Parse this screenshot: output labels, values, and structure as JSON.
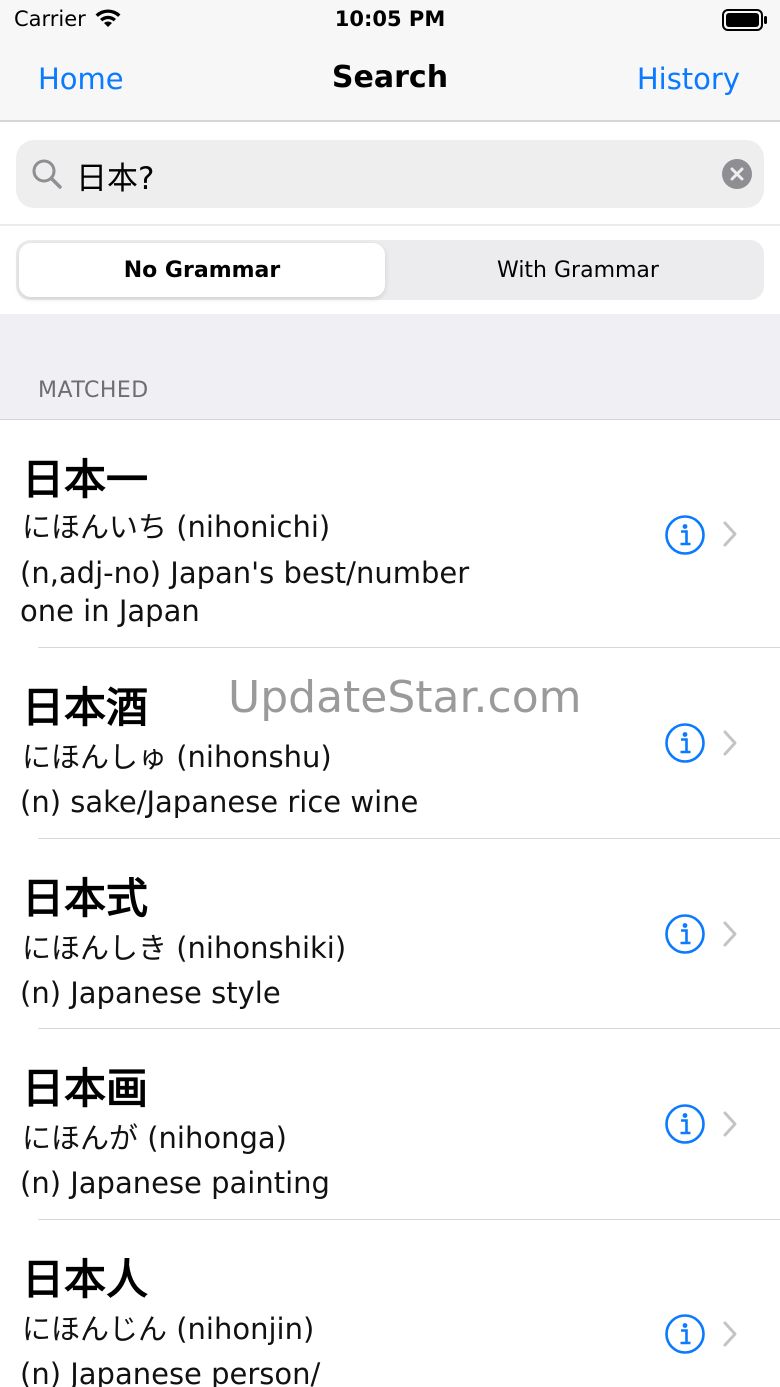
{
  "status_bar": {
    "carrier": "Carrier",
    "time": "10:05 PM"
  },
  "nav": {
    "back_label": "Home",
    "title": "Search",
    "right_label": "History"
  },
  "search": {
    "query": "日本?"
  },
  "segment": {
    "selected": "No Grammar",
    "other": "With Grammar"
  },
  "section": {
    "header": "MATCHED"
  },
  "results": [
    {
      "word": "日本一",
      "reading": "にほんいち (nihonichi)",
      "definition": "(n,adj-no) Japan's best/number one in Japan"
    },
    {
      "word": "日本酒",
      "reading": "にほんしゅ (nihonshu)",
      "definition": "(n) sake/Japanese rice wine"
    },
    {
      "word": "日本式",
      "reading": "にほんしき (nihonshiki)",
      "definition": "(n) Japanese style"
    },
    {
      "word": "日本画",
      "reading": "にほんが (nihonga)",
      "definition": "(n) Japanese painting"
    },
    {
      "word": "日本人",
      "reading": "にほんじん (nihonjin)",
      "definition": "(n) Japanese person/"
    }
  ],
  "watermark": "UpdateStar.com",
  "colors": {
    "accent": "#0a7aff",
    "group_background": "#efeff4",
    "secondary_text": "#6d6d72"
  }
}
